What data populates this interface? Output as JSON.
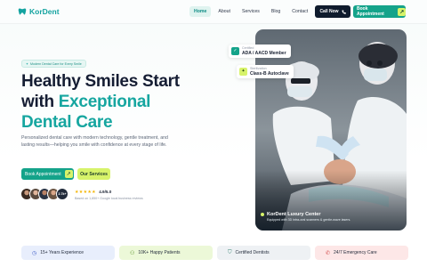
{
  "brand": {
    "name": "KorDent",
    "accent": "#14a38a",
    "lime": "#d7f36a"
  },
  "nav": {
    "items": [
      {
        "label": "Home",
        "active": true
      },
      {
        "label": "About",
        "active": false
      },
      {
        "label": "Services",
        "active": false
      },
      {
        "label": "Blog",
        "active": false
      },
      {
        "label": "Contact",
        "active": false
      }
    ],
    "call_label": "Call Now",
    "book_label": "Book Appointment"
  },
  "hero": {
    "badge": "Modern Dental Care for Every Smile",
    "headline_line1": "Healthy Smiles Start",
    "headline_line2_plain": "with ",
    "headline_line2_accent": "Exceptional",
    "headline_line3_accent": "Dental Care",
    "description": "Personalized dental care with modern technology, gentle treatment, and lasting results—helping you smile with confidence at every stage of life.",
    "primary_button": "Book Appointment",
    "secondary_button": "Our Services",
    "patient_count_badge": "2.7k+",
    "rating_value": "4.9/5.0",
    "rating_note": "Based on 1,850+ Google local business reviews",
    "icons": {
      "stars": "star-icon",
      "arrow": "arrow-up-right-icon",
      "phone": "phone-icon"
    }
  },
  "hero_image": {
    "cert1_label": "Certified",
    "cert1_value": "ADA / AACD Member",
    "cert2_label": "Sterilization",
    "cert2_value": "Class-B Autoclave",
    "caption_title": "KorDent Luxury Center",
    "caption_sub": "Equipped with 3D intra-oral scanners & gentle-wave lasers."
  },
  "stats": [
    {
      "label": "15+ Years Experience",
      "icon": "clock-icon",
      "bg": "#e8eefc",
      "fg": "#4361c7"
    },
    {
      "label": "10K+ Happy Patients",
      "icon": "users-icon",
      "bg": "#ecf8d8",
      "fg": "#4b8a1a"
    },
    {
      "label": "Certified Dentists",
      "icon": "shield-icon",
      "bg": "#eef1f4",
      "fg": "#2f7f6e"
    },
    {
      "label": "24/7 Emergency Care",
      "icon": "phone-icon",
      "bg": "#fde7e7",
      "fg": "#d34b4b"
    }
  ]
}
